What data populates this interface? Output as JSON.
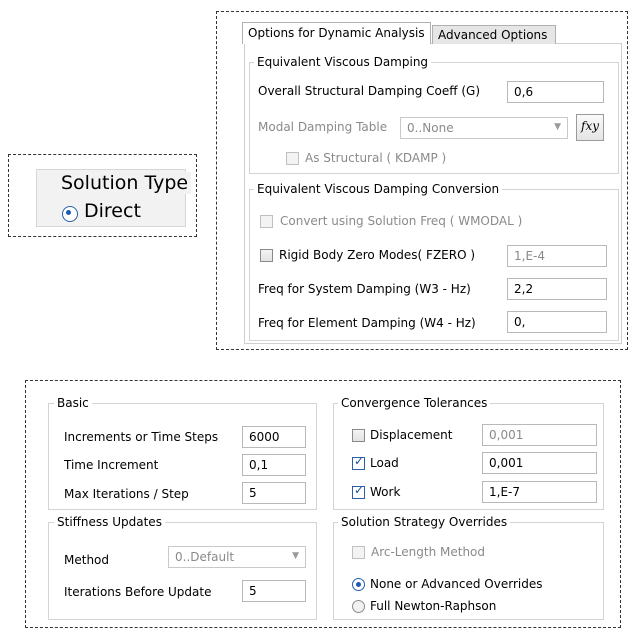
{
  "solution_type": {
    "title": "Solution Type",
    "option_direct": "Direct"
  },
  "dynamic": {
    "tabs": [
      "Options for Dynamic Analysis",
      "Advanced Options"
    ],
    "viscous": {
      "title": "Equivalent Viscous Damping",
      "overall_label": "Overall Structural Damping Coeff (G)",
      "overall_value": "0,6",
      "modal_label": "Modal Damping Table",
      "modal_value": "0..None",
      "fxy_label": "fxy",
      "as_structural_label": "As Structural ( KDAMP )"
    },
    "conversion": {
      "title": "Equivalent Viscous Damping Conversion",
      "convert_label": "Convert using Solution Freq ( WMODAL )",
      "rigid_label": "Rigid Body Zero Modes( FZERO )",
      "rigid_value": "1,E-4",
      "w3_label": "Freq for System Damping (W3 - Hz)",
      "w3_value": "2,2",
      "w4_label": "Freq for Element Damping (W4 - Hz)",
      "w4_value": "0,"
    }
  },
  "basic": {
    "title": "Basic",
    "rows": [
      {
        "label": "Increments or Time Steps",
        "value": "6000"
      },
      {
        "label": "Time Increment",
        "value": "0,1"
      },
      {
        "label": "Max Iterations / Step",
        "value": "5"
      }
    ]
  },
  "convergence": {
    "title": "Convergence Tolerances",
    "rows": [
      {
        "label": "Displacement",
        "value": "0,001"
      },
      {
        "label": "Load",
        "value": "0,001"
      },
      {
        "label": "Work",
        "value": "1,E-7"
      }
    ]
  },
  "stiffness": {
    "title": "Stiffness Updates",
    "method_label": "Method",
    "method_value": "0..Default",
    "iter_label": "Iterations Before Update",
    "iter_value": "5"
  },
  "strategy": {
    "title": "Solution Strategy Overrides",
    "arc_label": "Arc-Length Method",
    "none_label": "None or Advanced Overrides",
    "full_label": "Full Newton-Raphson"
  }
}
